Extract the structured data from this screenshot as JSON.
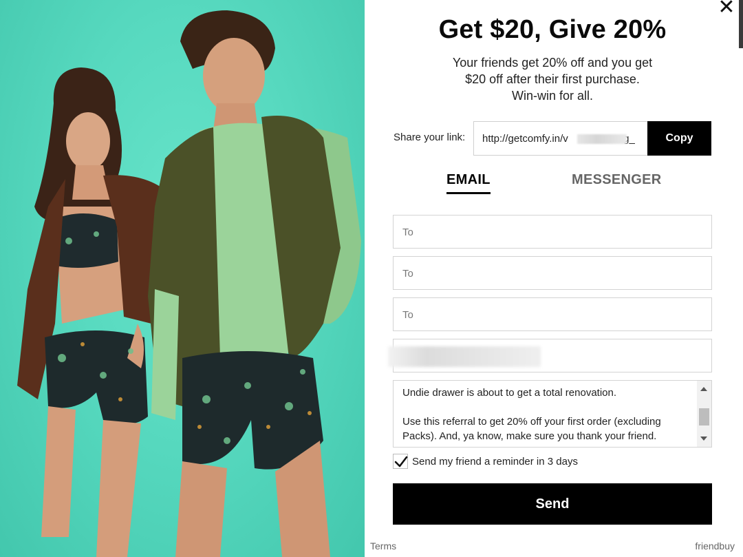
{
  "modal": {
    "headline": "Get $20, Give 20%",
    "subtext_lines": [
      "Your friends get 20% off and you get",
      "$20 off after their first purchase.",
      "Win-win for all."
    ],
    "close_icon": "close-icon"
  },
  "share": {
    "label": "Share your link:",
    "link_prefix": "http://getcomfy.in/v",
    "link_suffix": "ng_",
    "copy_label": "Copy"
  },
  "tabs": [
    {
      "label": "EMAIL",
      "active": true
    },
    {
      "label": "MESSENGER",
      "active": false
    }
  ],
  "form": {
    "to_fields": [
      {
        "placeholder": "To"
      },
      {
        "placeholder": "To"
      },
      {
        "placeholder": "To"
      }
    ],
    "message_paragraphs": [
      "Undie drawer is about to get a total renovation.",
      "Use this referral to get 20% off your first order (excluding Packs). And, ya know, make sure you thank your friend."
    ],
    "reminder_label": "Send my friend a reminder in 3 days",
    "reminder_checked": true,
    "send_label": "Send"
  },
  "footer": {
    "terms": "Terms",
    "brand": "friendbuy"
  },
  "colors": {
    "photo_background": "#57d9bf",
    "button": "#000000",
    "active_tab": "#000000",
    "inactive_tab": "#666666"
  }
}
